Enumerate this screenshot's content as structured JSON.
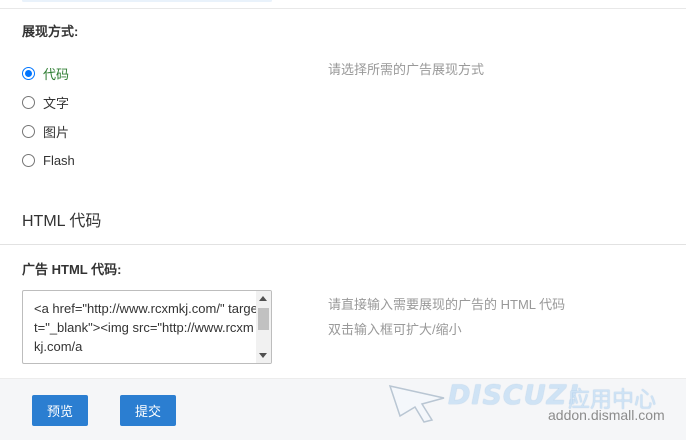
{
  "display": {
    "label": "展现方式:",
    "hint": "请选择所需的广告展现方式",
    "options": [
      {
        "label": "代码",
        "selected": true
      },
      {
        "label": "文字",
        "selected": false
      },
      {
        "label": "图片",
        "selected": false
      },
      {
        "label": "Flash",
        "selected": false
      }
    ]
  },
  "html_section": {
    "title": "HTML 代码"
  },
  "html_code": {
    "label": "广告 HTML 代码:",
    "value": "<a href=\"http://www.rcxmkj.com/\" target=\"_blank\"><img src=\"http://www.rcxmkj.com/a",
    "hint_line1": "请直接输入需要展现的广告的 HTML 代码",
    "hint_line2": "双击输入框可扩大/缩小"
  },
  "buttons": {
    "preview": "预览",
    "submit": "提交"
  },
  "watermark": {
    "brand": "DISCUZ!",
    "brand_cn": "应用中心",
    "url": "addon.dismall.com"
  },
  "colors": {
    "accent": "#2b7ed1",
    "radio_selected": "#0075ff",
    "selected_label": "#2e7d32",
    "hint_text": "#999999"
  }
}
